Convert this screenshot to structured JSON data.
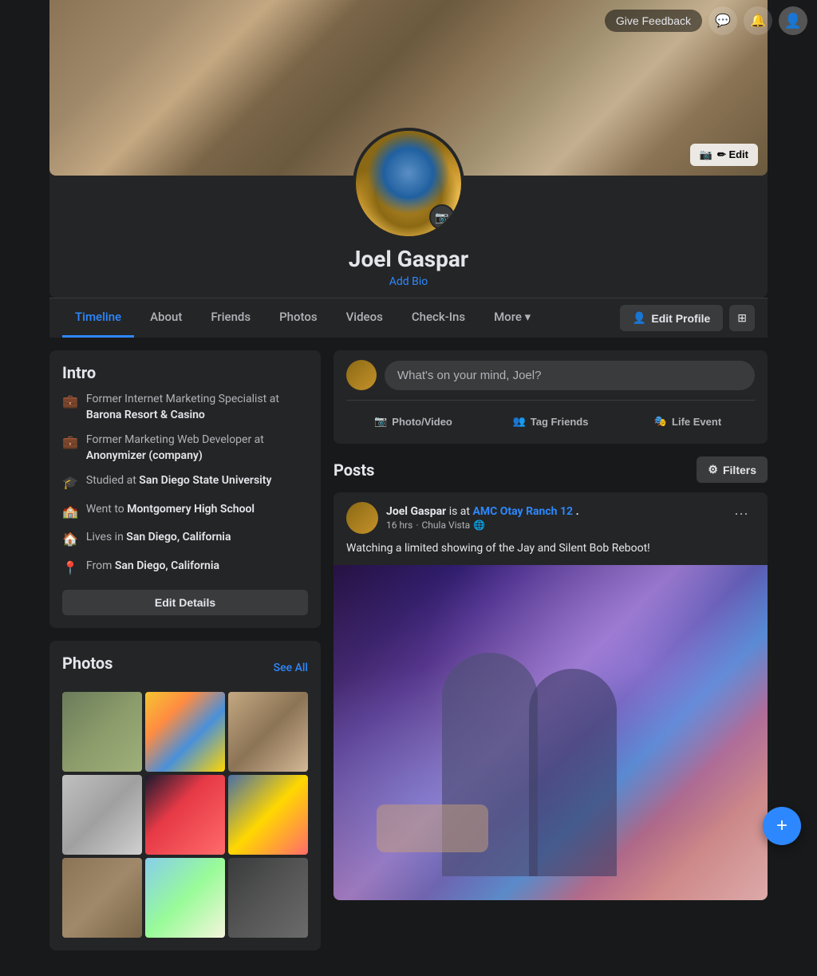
{
  "topnav": {
    "give_feedback": "Give Feedback",
    "messenger_icon": "💬",
    "bell_icon": "🔔"
  },
  "cover": {
    "edit_label": "✏ Edit"
  },
  "profile": {
    "name": "Joel Gaspar",
    "add_bio": "Add Bio"
  },
  "tabs": [
    {
      "id": "timeline",
      "label": "Timeline",
      "active": true
    },
    {
      "id": "about",
      "label": "About"
    },
    {
      "id": "friends",
      "label": "Friends"
    },
    {
      "id": "photos",
      "label": "Photos"
    },
    {
      "id": "videos",
      "label": "Videos"
    },
    {
      "id": "checkins",
      "label": "Check-Ins"
    },
    {
      "id": "more",
      "label": "More ▾"
    }
  ],
  "tab_actions": {
    "edit_profile": "Edit Profile",
    "edit_profile_icon": "👤"
  },
  "intro": {
    "title": "Intro",
    "items": [
      {
        "icon": "💼",
        "text_prefix": "Former Internet Marketing Specialist at ",
        "highlight": "Barona Resort & Casino"
      },
      {
        "icon": "💼",
        "text_prefix": "Former Marketing Web Developer at ",
        "highlight": "Anonymizer (company)"
      },
      {
        "icon": "🎓",
        "text_prefix": "Studied at ",
        "highlight": "San Diego State University"
      },
      {
        "icon": "🏫",
        "text_prefix": "Went to ",
        "highlight": "Montgomery High School"
      },
      {
        "icon": "🏠",
        "text_prefix": "Lives in ",
        "highlight": "San Diego, California"
      },
      {
        "icon": "📍",
        "text_prefix": "From ",
        "highlight": "San Diego, California"
      }
    ],
    "edit_details": "Edit Details"
  },
  "photos_section": {
    "title": "Photos",
    "see_all": "See All"
  },
  "add_post": {
    "placeholder": "What's on your mind, Joel?",
    "actions": [
      {
        "id": "photo_video",
        "icon": "📷",
        "label": "Photo/Video"
      },
      {
        "id": "tag_friends",
        "icon": "👥",
        "label": "Tag Friends"
      },
      {
        "id": "life_event",
        "icon": "🎭",
        "label": "Life Event"
      }
    ]
  },
  "posts_section": {
    "title": "Posts",
    "filters": "Filters",
    "filter_icon": "⚙"
  },
  "post": {
    "author_name": "Joel Gaspar",
    "at_text": " is at ",
    "location": "AMC Otay Ranch 12",
    "location_suffix": ".",
    "time": "16 hrs",
    "location_tag": "Chula Vista",
    "globe_icon": "🌐",
    "text": "Watching a limited showing of the Jay and Silent Bob Reboot!",
    "more_icon": "···"
  },
  "fab": {
    "icon": "+"
  }
}
